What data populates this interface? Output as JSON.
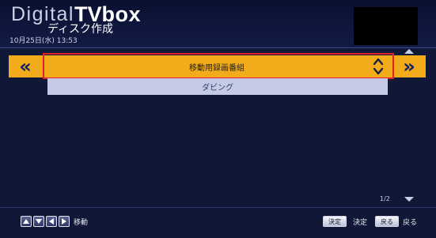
{
  "header": {
    "brand_light": "Digital",
    "brand_bold": "TV",
    "brand_bold2": "box",
    "title": "ディスク作成",
    "datetime": "10月25日(水) 13:53"
  },
  "selector": {
    "left_arrow": "«",
    "right_arrow": "»",
    "value": "移動用録画番組",
    "options": [
      "ダビング"
    ]
  },
  "pagination": {
    "page": "1/2"
  },
  "footer": {
    "move_label": "移動",
    "decide_button": "決定",
    "decide_label": "決定",
    "back_button": "戻る",
    "back_label": "戻る"
  },
  "colors": {
    "background": "#101737",
    "accent_orange": "#f2ab1b",
    "highlight_red": "#e0202a",
    "option_bg": "#c5cbe6"
  },
  "icons": [
    "up-key-icon",
    "down-key-icon",
    "left-key-icon",
    "right-key-icon",
    "spinner-updown-icon",
    "scroll-up-icon",
    "scroll-down-icon"
  ]
}
